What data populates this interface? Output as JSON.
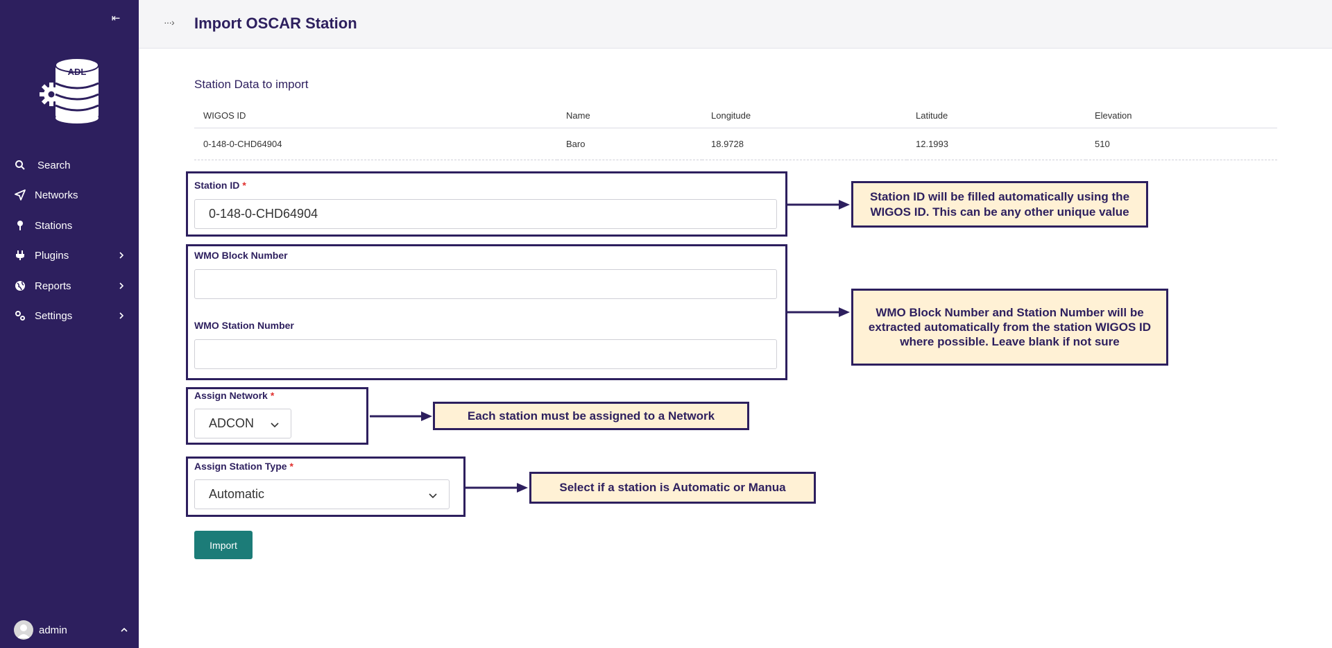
{
  "sidebar": {
    "logo_text": "ADL",
    "items": [
      {
        "label": "Search",
        "icon": "search-icon"
      },
      {
        "label": "Networks",
        "icon": "send-icon"
      },
      {
        "label": "Stations",
        "icon": "pin-icon"
      },
      {
        "label": "Plugins",
        "icon": "plug-icon"
      },
      {
        "label": "Reports",
        "icon": "globe-icon"
      },
      {
        "label": "Settings",
        "icon": "settings-icon"
      }
    ],
    "user": {
      "name": "admin"
    }
  },
  "header": {
    "title": "Import OSCAR Station"
  },
  "main": {
    "section_title": "Station Data to import",
    "table": {
      "columns": [
        "WIGOS ID",
        "Name",
        "Longitude",
        "Latitude",
        "Elevation"
      ],
      "rows": [
        [
          "0-148-0-CHD64904",
          "Baro",
          "18.9728",
          "12.1993",
          "510"
        ]
      ]
    },
    "form": {
      "station_id": {
        "label": "Station ID",
        "required_mark": "*",
        "value": "0-148-0-CHD64904"
      },
      "wmo_block": {
        "label": "WMO Block Number",
        "value": ""
      },
      "wmo_station": {
        "label": "WMO Station Number",
        "value": ""
      },
      "network": {
        "label": "Assign Network",
        "required_mark": "*",
        "selected": "ADCON"
      },
      "station_type": {
        "label": "Assign Station Type",
        "required_mark": "*",
        "selected": "Automatic"
      },
      "import_button": "Import"
    }
  },
  "annotations": {
    "station_id_note": "Station ID will be filled automatically using the WIGOS ID. This can be any other unique value",
    "wmo_note": "WMO Block Number and Station Number will be extracted automatically from the station WIGOS ID where possible. Leave blank if not sure",
    "network_note": "Each station must be assigned to a Network",
    "type_note": "Select if a station is Automatic or Manua"
  },
  "colors": {
    "sidebar_bg": "#2d1f5e",
    "accent": "#1c7c78",
    "callout_bg": "#fff1d5",
    "required": "#e0312f"
  }
}
